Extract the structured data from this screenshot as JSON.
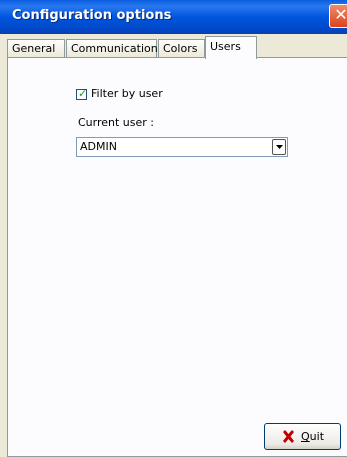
{
  "window": {
    "title": "Configuration options"
  },
  "tabs": [
    {
      "label": "General"
    },
    {
      "label": "Communication"
    },
    {
      "label": "Colors"
    },
    {
      "label": "Users"
    }
  ],
  "active_tab": "Users",
  "users": {
    "filter_checkbox": {
      "label": "Filter by user",
      "checked": true
    },
    "current_user_label": "Current user :",
    "current_user_value": "ADMIN"
  },
  "footer": {
    "quit_button": {
      "mnemonic": "Q",
      "rest": "uit"
    }
  },
  "colors": {
    "titlebar": "#0054e3",
    "close": "#d9431c",
    "quit_icon": "#c00000"
  },
  "icons": {
    "close": "close-icon",
    "dropdown": "chevron-down-icon",
    "quit": "x-mark-icon",
    "check": "checkmark-icon"
  }
}
